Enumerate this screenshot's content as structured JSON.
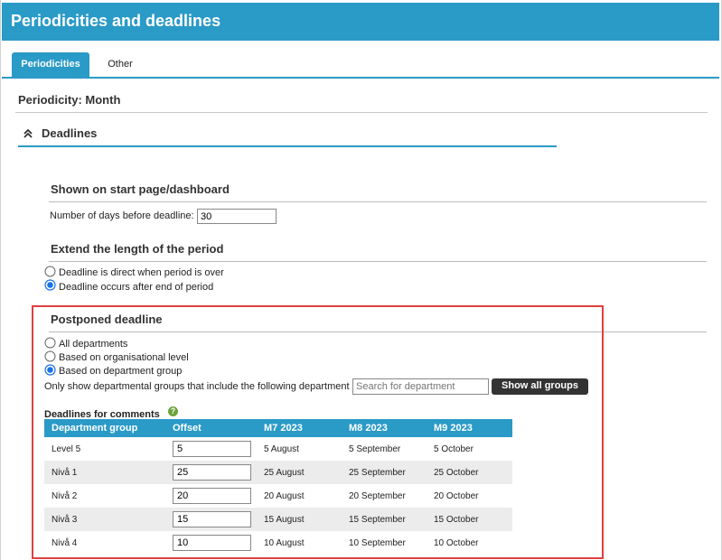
{
  "header": {
    "title": "Periodicities and deadlines"
  },
  "tabs": [
    {
      "label": "Periodicities",
      "active": true
    },
    {
      "label": "Other",
      "active": false
    }
  ],
  "periodicity_label": "Periodicity: Month",
  "deadlines_section": {
    "label": "Deadlines",
    "expanded": true
  },
  "start_page": {
    "title": "Shown on start page/dashboard",
    "days_label": "Number of days before deadline:",
    "days_value": "30"
  },
  "extend_period": {
    "title": "Extend the length of the period",
    "options": [
      {
        "label": "Deadline is direct when period is over",
        "checked": false
      },
      {
        "label": "Deadline occurs after end of period",
        "checked": true
      }
    ]
  },
  "postponed": {
    "title": "Postponed deadline",
    "options": [
      {
        "label": "All departments",
        "checked": false
      },
      {
        "label": "Based on organisational level",
        "checked": false
      },
      {
        "label": "Based on department group",
        "checked": true
      }
    ],
    "filter_label": "Only show departmental groups that include the following department",
    "search_placeholder": "Search for department",
    "show_all_button": "Show all groups",
    "comments_label": "Deadlines for comments",
    "help_icon_text": "?"
  },
  "table": {
    "columns": [
      "Department group",
      "Offset",
      "M7 2023",
      "M8 2023",
      "M9 2023"
    ],
    "rows": [
      {
        "group": "Level 5",
        "offset": "5",
        "m7": "5 August",
        "m8": "5 September",
        "m9": "5 October"
      },
      {
        "group": "Nivå 1",
        "offset": "25",
        "m7": "25 August",
        "m8": "25 September",
        "m9": "25 October"
      },
      {
        "group": "Nivå 2",
        "offset": "20",
        "m7": "20 August",
        "m8": "20 September",
        "m9": "20 October"
      },
      {
        "group": "Nivå 3",
        "offset": "15",
        "m7": "15 August",
        "m8": "15 September",
        "m9": "15 October"
      },
      {
        "group": "Nivå 4",
        "offset": "10",
        "m7": "10 August",
        "m8": "10 September",
        "m9": "10 October"
      }
    ]
  },
  "colors": {
    "accent": "#2a9ac7",
    "highlight_box": "#e04040",
    "help_icon": "#6aa33a"
  }
}
